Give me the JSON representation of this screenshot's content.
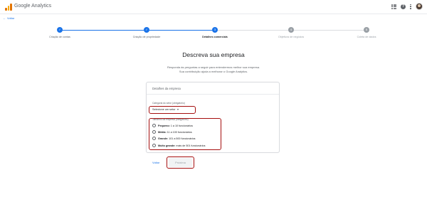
{
  "header": {
    "app_title": "Google Analytics"
  },
  "nav": {
    "back_label": "Voltar"
  },
  "stepper": [
    {
      "label": "Criação de contas",
      "status": "done",
      "marker": "✓"
    },
    {
      "label": "Criação de propriedade",
      "status": "done",
      "marker": "✓"
    },
    {
      "label": "Detalhes comerciais",
      "status": "active",
      "marker": "3"
    },
    {
      "label": "Objetivos de negócios",
      "status": "todo",
      "marker": "4"
    },
    {
      "label": "Coleta de dados",
      "status": "todo",
      "marker": "5"
    }
  ],
  "main": {
    "title": "Descreva sua empresa",
    "subtitle_line1": "Responda às perguntas a seguir para entendermos melhor sua empresa.",
    "subtitle_line2": "Sua contribuição ajuda a melhorar o Google Analytics."
  },
  "card": {
    "title": "Detalhes da empresa",
    "category_label": "Categoria do setor (obrigatório)",
    "category_value": "Selecione um setor",
    "size_label": "Tamanho da empresa (obrigatório)",
    "sizes": [
      {
        "name": "Pequeno:",
        "desc": "1 a 10 funcionários"
      },
      {
        "name": "Média:",
        "desc": "11 a 100 funcionários"
      },
      {
        "name": "Grande:",
        "desc": "101 a 500 funcionários"
      },
      {
        "name": "Muito grande:",
        "desc": "mais de 501 funcionários"
      }
    ]
  },
  "footer": {
    "back_label": "Voltar",
    "next_label": "Próxima"
  },
  "colors": {
    "accent": "#1a73e8",
    "error_outline": "#a50e0e"
  }
}
